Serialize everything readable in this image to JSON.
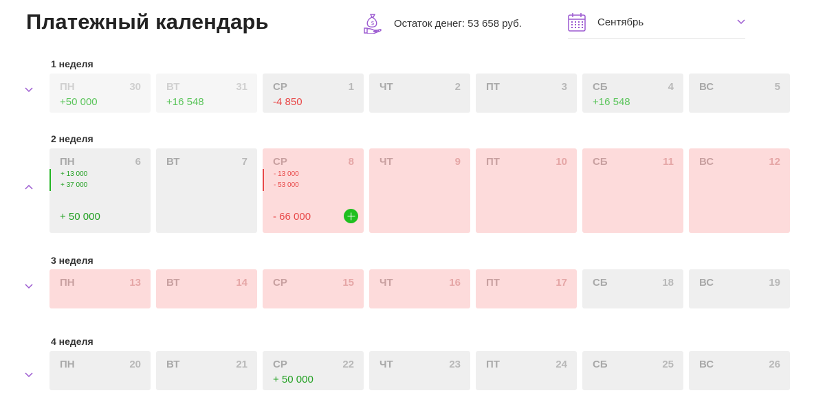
{
  "title": "Платежный календарь",
  "balance": {
    "icon": "money-hand-icon",
    "text": "Остаток денег: 53 658 руб."
  },
  "month": {
    "icon": "calendar-icon",
    "value": "Сентябрь"
  },
  "colors": {
    "accent": "#9b59d0",
    "positive": "#5cc55c",
    "negative": "#e84848",
    "pink_cell": "#fddbdb",
    "gray_cell": "#efefef"
  },
  "weeks": [
    {
      "title": "1 неделя",
      "days": [
        {
          "name": "ПН",
          "num": "30",
          "amount": "+50 000"
        },
        {
          "name": "ВТ",
          "num": "31",
          "amount": "+16 548"
        },
        {
          "name": "СР",
          "num": "1",
          "amount": "-4 850"
        },
        {
          "name": "ЧТ",
          "num": "2"
        },
        {
          "name": "ПТ",
          "num": "3"
        },
        {
          "name": "СБ",
          "num": "4",
          "amount": "+16 548"
        },
        {
          "name": "ВС",
          "num": "5"
        }
      ]
    },
    {
      "title": "2 неделя",
      "days": [
        {
          "name": "ПН",
          "num": "6",
          "details": [
            "+ 13 000",
            "+ 37 000"
          ],
          "total": "+ 50 000"
        },
        {
          "name": "ВТ",
          "num": "7"
        },
        {
          "name": "СР",
          "num": "8",
          "details": [
            "- 13 000",
            "- 53 000"
          ],
          "total": "- 66 000"
        },
        {
          "name": "ЧТ",
          "num": "9"
        },
        {
          "name": "ПТ",
          "num": "10"
        },
        {
          "name": "СБ",
          "num": "11"
        },
        {
          "name": "ВС",
          "num": "12"
        }
      ]
    },
    {
      "title": "3 неделя",
      "days": [
        {
          "name": "ПН",
          "num": "13"
        },
        {
          "name": "ВТ",
          "num": "14"
        },
        {
          "name": "СР",
          "num": "15"
        },
        {
          "name": "ЧТ",
          "num": "16"
        },
        {
          "name": "ПТ",
          "num": "17"
        },
        {
          "name": "СБ",
          "num": "18"
        },
        {
          "name": "ВС",
          "num": "19"
        }
      ]
    },
    {
      "title": "4 неделя",
      "days": [
        {
          "name": "ПН",
          "num": "20"
        },
        {
          "name": "ВТ",
          "num": "21"
        },
        {
          "name": "СР",
          "num": "22",
          "amount": "+ 50 000"
        },
        {
          "name": "ЧТ",
          "num": "23"
        },
        {
          "name": "ПТ",
          "num": "24"
        },
        {
          "name": "СБ",
          "num": "25"
        },
        {
          "name": "ВС",
          "num": "26"
        }
      ]
    }
  ]
}
